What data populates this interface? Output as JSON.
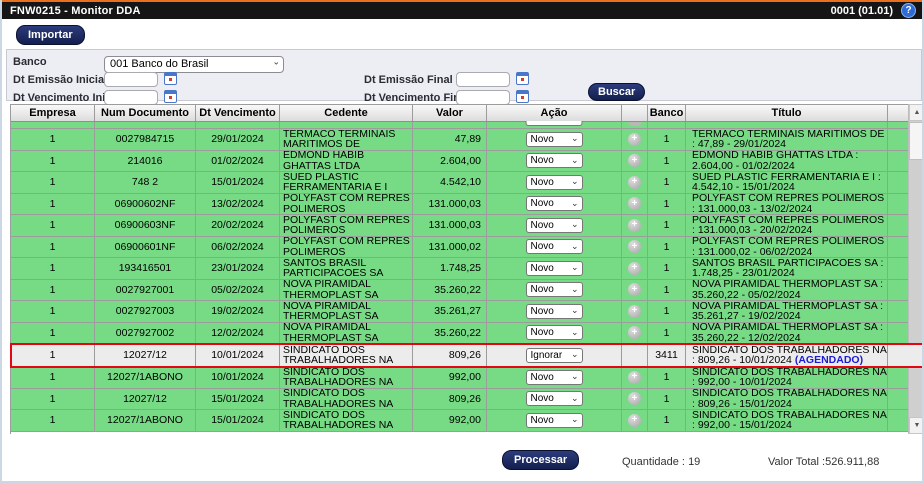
{
  "titlebar": {
    "title": "FNW0215 - Monitor DDA",
    "version_code": "0001 (01.01)",
    "help_glyph": "?",
    "accent_orange": "#E8701E",
    "bar_color": "#151515"
  },
  "toolbar": {
    "importar_label": "Importar"
  },
  "filters": {
    "banco_label": "Banco",
    "banco_value": "001 Banco do Brasil",
    "dt_emissao_inicial_label": "Dt Emissão Inicial",
    "dt_emissao_final_label": "Dt Emissão Final",
    "dt_vencimento_inicial_label": "Dt Vencimento Inicial",
    "dt_vencimento_final_label": "Dt Vencimento Final",
    "buscar_label": "Buscar",
    "date_inputs_value": ""
  },
  "table": {
    "columns": [
      "Empresa",
      "Num Documento",
      "Dt Vencimento",
      "Cedente",
      "Valor",
      "Ação",
      "",
      "Banco",
      "Título",
      ""
    ],
    "row_green": "#77DB85",
    "highlight_bg": "#ECECEC",
    "highlight_border": "#E30613",
    "agendado_color": "#1B1BD6",
    "rows": [
      {
        "empresa": "1",
        "num": "0027984715",
        "venc": "29/01/2024",
        "cedente": "TERMACO TERMINAIS MARITIMOS DE",
        "valor": "47,89",
        "acao": "Novo",
        "plus": true,
        "banco": "1",
        "titulo": "TERMACO TERMINAIS MARITIMOS DE : 47,89 - 29/01/2024",
        "agendado": "",
        "highlighted": false
      },
      {
        "empresa": "1",
        "num": "214016",
        "venc": "01/02/2024",
        "cedente": "EDMOND HABIB GHATTAS LTDA",
        "valor": "2.604,00",
        "acao": "Novo",
        "plus": true,
        "banco": "1",
        "titulo": "EDMOND HABIB GHATTAS LTDA : 2.604,00 - 01/02/2024",
        "agendado": "",
        "highlighted": false
      },
      {
        "empresa": "1",
        "num": "748 2",
        "venc": "15/01/2024",
        "cedente": "SUED PLASTIC FERRAMENTARIA E I",
        "valor": "4.542,10",
        "acao": "Novo",
        "plus": true,
        "banco": "1",
        "titulo": "SUED PLASTIC FERRAMENTARIA E I : 4.542,10 - 15/01/2024",
        "agendado": "",
        "highlighted": false
      },
      {
        "empresa": "1",
        "num": "06900602NF",
        "venc": "13/02/2024",
        "cedente": "POLYFAST COM REPRES POLIMEROS",
        "valor": "131.000,03",
        "acao": "Novo",
        "plus": true,
        "banco": "1",
        "titulo": "POLYFAST COM REPRES POLIMEROS : 131.000,03 - 13/02/2024",
        "agendado": "",
        "highlighted": false
      },
      {
        "empresa": "1",
        "num": "06900603NF",
        "venc": "20/02/2024",
        "cedente": "POLYFAST COM REPRES POLIMEROS",
        "valor": "131.000,03",
        "acao": "Novo",
        "plus": true,
        "banco": "1",
        "titulo": "POLYFAST COM REPRES POLIMEROS : 131.000,03 - 20/02/2024",
        "agendado": "",
        "highlighted": false
      },
      {
        "empresa": "1",
        "num": "06900601NF",
        "venc": "06/02/2024",
        "cedente": "POLYFAST COM REPRES POLIMEROS",
        "valor": "131.000,02",
        "acao": "Novo",
        "plus": true,
        "banco": "1",
        "titulo": "POLYFAST COM REPRES POLIMEROS : 131.000,02 - 06/02/2024",
        "agendado": "",
        "highlighted": false
      },
      {
        "empresa": "1",
        "num": "193416501",
        "venc": "23/01/2024",
        "cedente": "SANTOS BRASIL PARTICIPACOES SA",
        "valor": "1.748,25",
        "acao": "Novo",
        "plus": true,
        "banco": "1",
        "titulo": "SANTOS BRASIL PARTICIPACOES SA : 1.748,25 - 23/01/2024",
        "agendado": "",
        "highlighted": false
      },
      {
        "empresa": "1",
        "num": "0027927001",
        "venc": "05/02/2024",
        "cedente": "NOVA PIRAMIDAL THERMOPLAST SA",
        "valor": "35.260,22",
        "acao": "Novo",
        "plus": true,
        "banco": "1",
        "titulo": "NOVA PIRAMIDAL THERMOPLAST SA : 35.260,22 - 05/02/2024",
        "agendado": "",
        "highlighted": false
      },
      {
        "empresa": "1",
        "num": "0027927003",
        "venc": "19/02/2024",
        "cedente": "NOVA PIRAMIDAL THERMOPLAST SA",
        "valor": "35.261,27",
        "acao": "Novo",
        "plus": true,
        "banco": "1",
        "titulo": "NOVA PIRAMIDAL THERMOPLAST SA : 35.261,27 - 19/02/2024",
        "agendado": "",
        "highlighted": false
      },
      {
        "empresa": "1",
        "num": "0027927002",
        "venc": "12/02/2024",
        "cedente": "NOVA PIRAMIDAL THERMOPLAST SA",
        "valor": "35.260,22",
        "acao": "Novo",
        "plus": true,
        "banco": "1",
        "titulo": "NOVA PIRAMIDAL THERMOPLAST SA : 35.260,22 - 12/02/2024",
        "agendado": "",
        "highlighted": false
      },
      {
        "empresa": "1",
        "num": "12027/12",
        "venc": "10/01/2024",
        "cedente": "SINDICATO DOS TRABALHADORES NA",
        "valor": "809,26",
        "acao": "Ignorar",
        "plus": false,
        "banco": "3411",
        "titulo": "SINDICATO DOS TRABALHADORES NA : 809,26 - 10/01/2024",
        "agendado": "(AGENDADO)",
        "highlighted": true
      },
      {
        "empresa": "1",
        "num": "12027/1ABONO",
        "venc": "10/01/2024",
        "cedente": "SINDICATO DOS TRABALHADORES NA",
        "valor": "992,00",
        "acao": "Novo",
        "plus": true,
        "banco": "1",
        "titulo": "SINDICATO DOS TRABALHADORES NA : 992,00 - 10/01/2024",
        "agendado": "",
        "highlighted": false
      },
      {
        "empresa": "1",
        "num": "12027/12",
        "venc": "15/01/2024",
        "cedente": "SINDICATO DOS TRABALHADORES NA",
        "valor": "809,26",
        "acao": "Novo",
        "plus": true,
        "banco": "1",
        "titulo": "SINDICATO DOS TRABALHADORES NA : 809,26 - 15/01/2024",
        "agendado": "",
        "highlighted": false
      },
      {
        "empresa": "1",
        "num": "12027/1ABONO",
        "venc": "15/01/2024",
        "cedente": "SINDICATO DOS TRABALHADORES NA",
        "valor": "992,00",
        "acao": "Novo",
        "plus": true,
        "banco": "1",
        "titulo": "SINDICATO DOS TRABALHADORES NA : 992,00 - 15/01/2024",
        "agendado": "",
        "highlighted": false
      }
    ]
  },
  "footer": {
    "processar_label": "Processar",
    "quantidade_label": "Quantidade : ",
    "quantidade_value": "19",
    "valor_total_label": "Valor Total :",
    "valor_total_value": "526.911,88"
  },
  "scrollbar": {
    "up_glyph": "▲",
    "down_glyph": "▼"
  }
}
